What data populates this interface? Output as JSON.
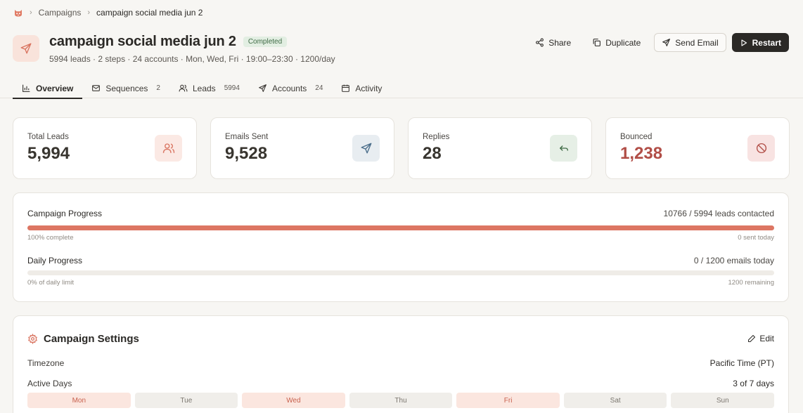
{
  "breadcrumb": {
    "items": [
      "Campaigns",
      "campaign social media jun 2"
    ]
  },
  "header": {
    "title": "campaign social media jun 2",
    "status": "Completed",
    "subtitle": "5994 leads · 2 steps · 24 accounts · Mon, Wed, Fri · 19:00–23:30 · 1200/day"
  },
  "actions": {
    "share": "Share",
    "duplicate": "Duplicate",
    "send_email": "Send Email",
    "restart": "Restart"
  },
  "tabs": [
    {
      "label": "Overview",
      "count": "",
      "icon": "bar-chart-icon"
    },
    {
      "label": "Sequences",
      "count": "2",
      "icon": "mail-icon"
    },
    {
      "label": "Leads",
      "count": "5994",
      "icon": "users-icon"
    },
    {
      "label": "Accounts",
      "count": "24",
      "icon": "send-icon"
    },
    {
      "label": "Activity",
      "count": "",
      "icon": "calendar-icon"
    }
  ],
  "stats": [
    {
      "label": "Total Leads",
      "value": "5,994",
      "icon": "users-icon",
      "color": "#d9735f",
      "bg": "#fbe9e4"
    },
    {
      "label": "Emails Sent",
      "value": "9,528",
      "icon": "send-icon",
      "color": "#4a6d8a",
      "bg": "#e8edf1"
    },
    {
      "label": "Replies",
      "value": "28",
      "icon": "reply-icon",
      "color": "#3f6b45",
      "bg": "#e6efe6"
    },
    {
      "label": "Bounced",
      "value": "1,238",
      "icon": "ban-icon",
      "color": "#b14e47",
      "bg": "#f8e3e2"
    }
  ],
  "progress": {
    "campaign_label": "Campaign Progress",
    "campaign_summary": "10766 / 5994 leads contacted",
    "campaign_fraction": 1.0,
    "campaign_complete": "100% complete",
    "campaign_sent_today": "0 sent today",
    "daily_label": "Daily Progress",
    "daily_summary": "0 / 1200 emails today",
    "daily_fraction": 0.0,
    "daily_limit": "0% of daily limit",
    "daily_remaining": "1200 remaining"
  },
  "settings": {
    "title": "Campaign Settings",
    "edit": "Edit",
    "timezone_label": "Timezone",
    "timezone_value": "Pacific Time (PT)",
    "active_days_label": "Active Days",
    "active_days_value": "3 of 7 days",
    "days": [
      {
        "label": "Mon",
        "active": true
      },
      {
        "label": "Tue",
        "active": false
      },
      {
        "label": "Wed",
        "active": true
      },
      {
        "label": "Thu",
        "active": false
      },
      {
        "label": "Fri",
        "active": true
      },
      {
        "label": "Sat",
        "active": false
      },
      {
        "label": "Sun",
        "active": false
      }
    ]
  },
  "colors": {
    "accent": "#dd7663",
    "dark": "#2b2926",
    "success": "#3f6b45",
    "danger": "#b14e47"
  }
}
